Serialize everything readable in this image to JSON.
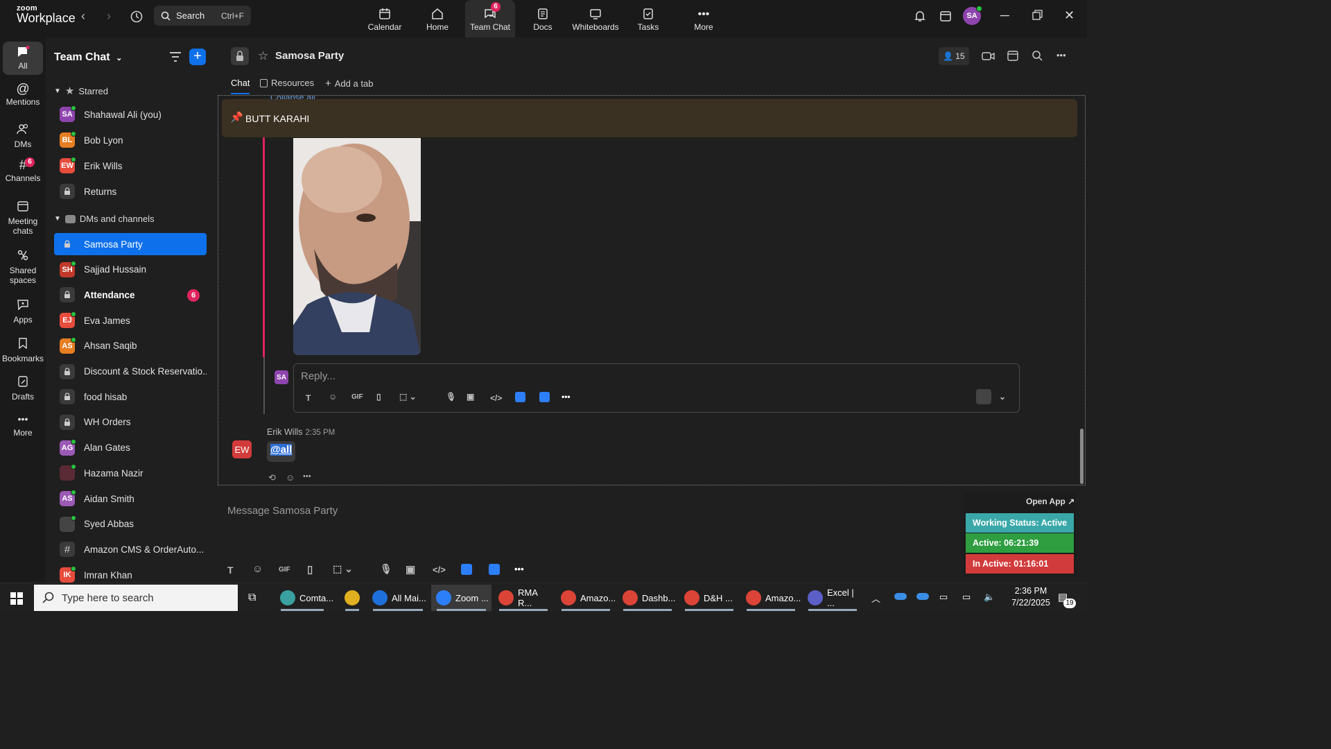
{
  "app": {
    "logo_top": "zoom",
    "logo_bottom": "Workplace",
    "search_label": "Search",
    "search_shortcut": "Ctrl+F",
    "nav": [
      {
        "label": "Calendar"
      },
      {
        "label": "Home"
      },
      {
        "label": "Team Chat",
        "badge": "6"
      },
      {
        "label": "Docs"
      },
      {
        "label": "Whiteboards"
      },
      {
        "label": "Tasks"
      },
      {
        "label": "More"
      }
    ],
    "profile_initials": "SA"
  },
  "rail": [
    {
      "label": "All"
    },
    {
      "label": "Mentions"
    },
    {
      "label": "DMs"
    },
    {
      "label": "Channels",
      "badge": "6"
    },
    {
      "label": "Meeting chats"
    },
    {
      "label": "Shared spaces"
    },
    {
      "label": "Apps"
    },
    {
      "label": "Bookmarks"
    },
    {
      "label": "Drafts"
    },
    {
      "label": "More"
    }
  ],
  "sidebar": {
    "title": "Team Chat",
    "starred_label": "Starred",
    "dms_label": "DMs and channels",
    "starred": [
      {
        "initials": "SA",
        "name": "Shahawal Ali (you)",
        "color": "#8e44ad"
      },
      {
        "initials": "BL",
        "name": "Bob Lyon",
        "color": "#e67e22"
      },
      {
        "initials": "EW",
        "name": "Erik Wills",
        "color": "#e74c3c"
      },
      {
        "initials": "",
        "name": "Returns",
        "color": ""
      }
    ],
    "channels": [
      {
        "initials": "",
        "name": "Samosa Party",
        "color": "",
        "selected": true
      },
      {
        "initials": "SH",
        "name": "Sajjad Hussain",
        "color": "#c0392b"
      },
      {
        "initials": "",
        "name": "Attendance",
        "color": "",
        "badge": "6",
        "bold": true
      },
      {
        "initials": "EJ",
        "name": "Eva James",
        "color": "#e74c3c"
      },
      {
        "initials": "AS",
        "name": "Ahsan Saqib",
        "color": "#e67e22"
      },
      {
        "initials": "",
        "name": "Discount & Stock Reservatio...",
        "color": ""
      },
      {
        "initials": "",
        "name": "food hisab",
        "color": ""
      },
      {
        "initials": "",
        "name": "WH Orders",
        "color": ""
      },
      {
        "initials": "AG",
        "name": "Alan Gates",
        "color": "#9b59b6"
      },
      {
        "initials": "",
        "name": "Hazama Nazir",
        "color": "#5a2a35"
      },
      {
        "initials": "AS",
        "name": "Aidan Smith",
        "color": "#9b59b6"
      },
      {
        "initials": "",
        "name": "Syed Abbas",
        "color": "#444"
      },
      {
        "initials": "#",
        "name": "Amazon CMS & OrderAuto...",
        "color": ""
      },
      {
        "initials": "IK",
        "name": "Imran Khan",
        "color": "#e74c3c"
      }
    ]
  },
  "channel": {
    "title": "Samosa Party",
    "member_count": "15",
    "tabs": [
      "Chat",
      "Resources",
      "Add a tab"
    ],
    "collapse_text": "Collapse all",
    "pinned_text": "BUTT KARAHI",
    "reply_placeholder": "Reply...",
    "reply_avatar": "SA",
    "message": {
      "author": "Erik Wills",
      "time": "2:35 PM",
      "avatar": "EW",
      "text": "@all"
    },
    "composer_placeholder": "Message Samosa Party",
    "gif_label": "GIF"
  },
  "status_widget": {
    "open_app": "Open App ↗",
    "working": "Working Status: Active",
    "active": "Active: 06:21:39",
    "inactive": "In Active: 01:16:01",
    "colors": {
      "working": "#3aa8a8",
      "active": "#2e9e40",
      "inactive": "#d23b3b"
    }
  },
  "taskbar": {
    "search_placeholder": "Type here to search",
    "apps": [
      {
        "label": "Comta..."
      },
      {
        "label": ""
      },
      {
        "label": "All Mai..."
      },
      {
        "label": "Zoom ..."
      },
      {
        "label": "RMA R..."
      },
      {
        "label": "Amazo..."
      },
      {
        "label": "Dashb..."
      },
      {
        "label": "D&H ..."
      },
      {
        "label": "Amazo..."
      },
      {
        "label": "Excel | ..."
      }
    ],
    "time": "2:36 PM",
    "date": "7/22/2025",
    "notif_count": "19"
  }
}
